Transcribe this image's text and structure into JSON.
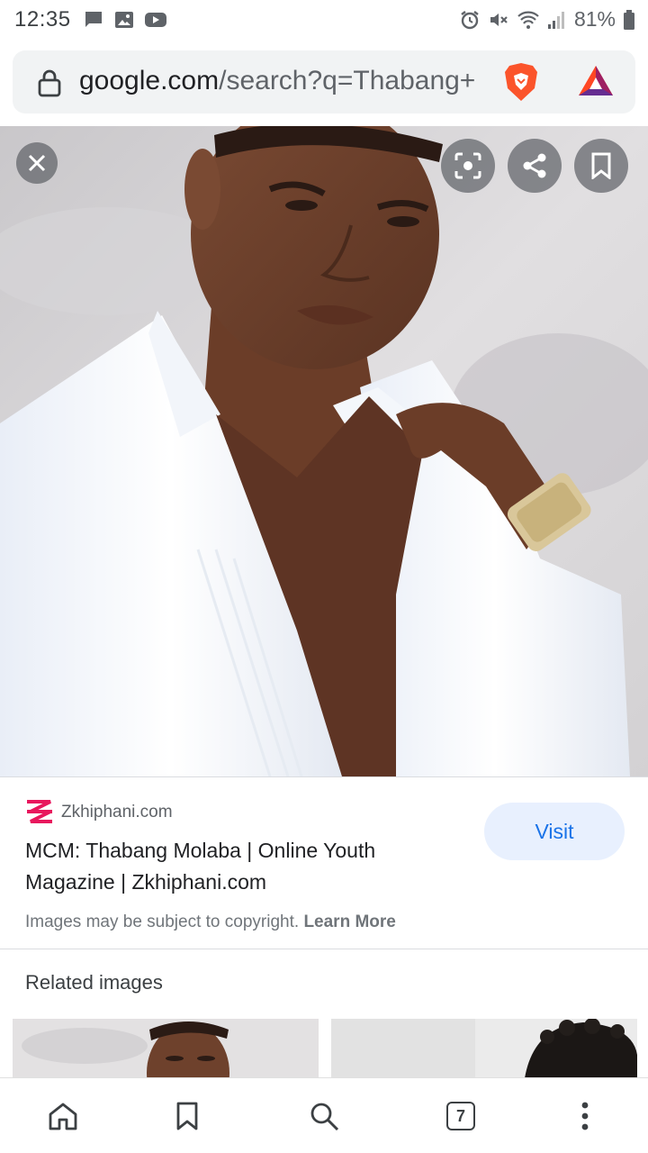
{
  "status_bar": {
    "time": "12:35",
    "battery_text": "81%",
    "left_icons": [
      "message-icon",
      "gallery-icon",
      "youtube-icon"
    ],
    "right_icons": [
      "alarm-icon",
      "mute-icon",
      "wifi-icon",
      "signal-icon",
      "battery-icon"
    ]
  },
  "browser": {
    "url_host": "google.com",
    "url_path": "/search?q=Thabang+",
    "icons": [
      "lock-icon",
      "brave-shield-icon",
      "bat-rewards-icon"
    ]
  },
  "viewer": {
    "image_alt": "Man in white shirt",
    "actions": [
      "close-icon",
      "lens-icon",
      "share-icon",
      "bookmark-icon"
    ]
  },
  "result": {
    "site_name": "Zkhiphani.com",
    "title": "MCM: Thabang Molaba | Online Youth Magazine | Zkhiphani.com",
    "visit_label": "Visit",
    "copyright_text": "Images may be subject to copyright.",
    "learn_more": "Learn More",
    "accent_color": "#1a73e8"
  },
  "related": {
    "heading": "Related images"
  },
  "bottom_nav": {
    "tab_count": "7",
    "items": [
      "home-icon",
      "bookmark-icon",
      "search-icon",
      "tabs-icon",
      "more-icon"
    ]
  }
}
